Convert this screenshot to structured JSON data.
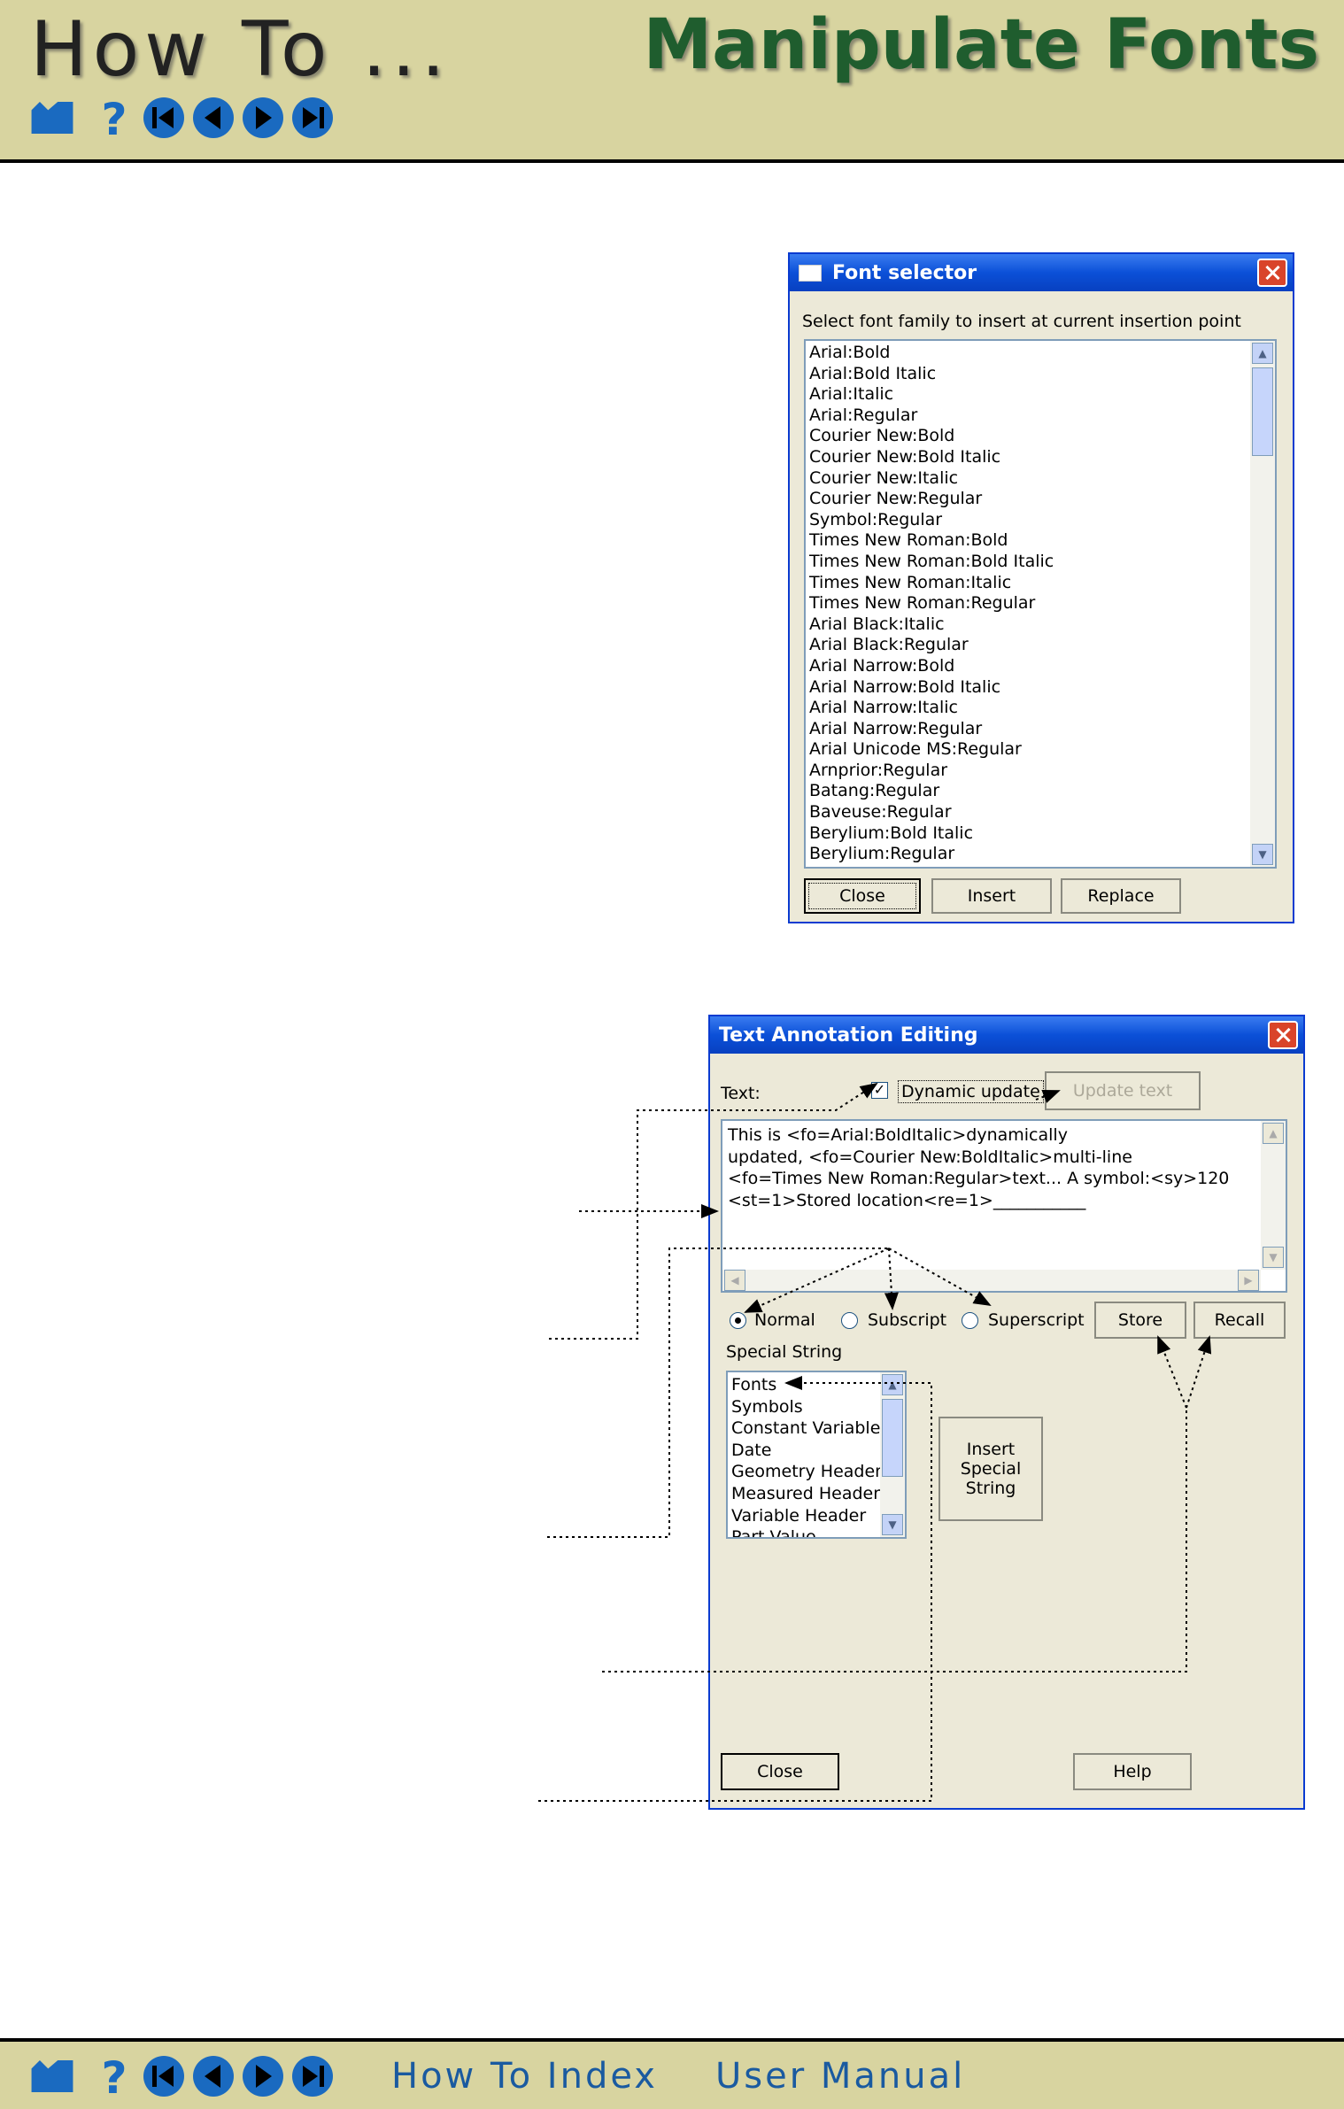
{
  "header": {
    "howto": "How To ...",
    "title": "Manipulate Fonts"
  },
  "footer": {
    "index_link": "How To Index",
    "manual_link": "User Manual"
  },
  "font_selector": {
    "title": "Font selector",
    "prompt": "Select font family to insert at current insertion point",
    "fonts": [
      "Arial:Bold",
      "Arial:Bold Italic",
      "Arial:Italic",
      "Arial:Regular",
      "Courier New:Bold",
      "Courier New:Bold Italic",
      "Courier New:Italic",
      "Courier New:Regular",
      "Symbol:Regular",
      "Times New Roman:Bold",
      "Times New Roman:Bold Italic",
      "Times New Roman:Italic",
      "Times New Roman:Regular",
      "Arial Black:Italic",
      "Arial Black:Regular",
      "Arial Narrow:Bold",
      "Arial Narrow:Bold Italic",
      "Arial Narrow:Italic",
      "Arial Narrow:Regular",
      "Arial Unicode MS:Regular",
      "Arnprior:Regular",
      "Batang:Regular",
      "Baveuse:Regular",
      "Berylium:Bold Italic",
      "Berylium:Regular"
    ],
    "close_label": "Close",
    "insert_label": "Insert",
    "replace_label": "Replace"
  },
  "text_editor": {
    "title": "Text Annotation Editing",
    "text_label": "Text:",
    "dynamic_label": "Dynamic update",
    "update_label": "Update text",
    "lines": [
      "This is <fo=Arial:BoldItalic>dynamically",
      "updated, <fo=Courier New:BoldItalic>multi-line",
      "<fo=Times New Roman:Regular>text... A symbol:<sy>120",
      "<st=1>Stored location<re=1>___________"
    ],
    "normal_label": "Normal",
    "subscript_label": "Subscript",
    "superscript_label": "Superscript",
    "store_label": "Store",
    "recall_label": "Recall",
    "special_label": "Special String",
    "special_items": [
      "Fonts",
      "Symbols",
      "Constant Variable",
      "Date",
      "Geometry Header",
      "Measured Header",
      "Variable Header",
      "Part Value"
    ],
    "insert_special_line1": "Insert",
    "insert_special_line2": "Special",
    "insert_special_line3": "String",
    "close_label": "Close",
    "help_label": "Help"
  }
}
